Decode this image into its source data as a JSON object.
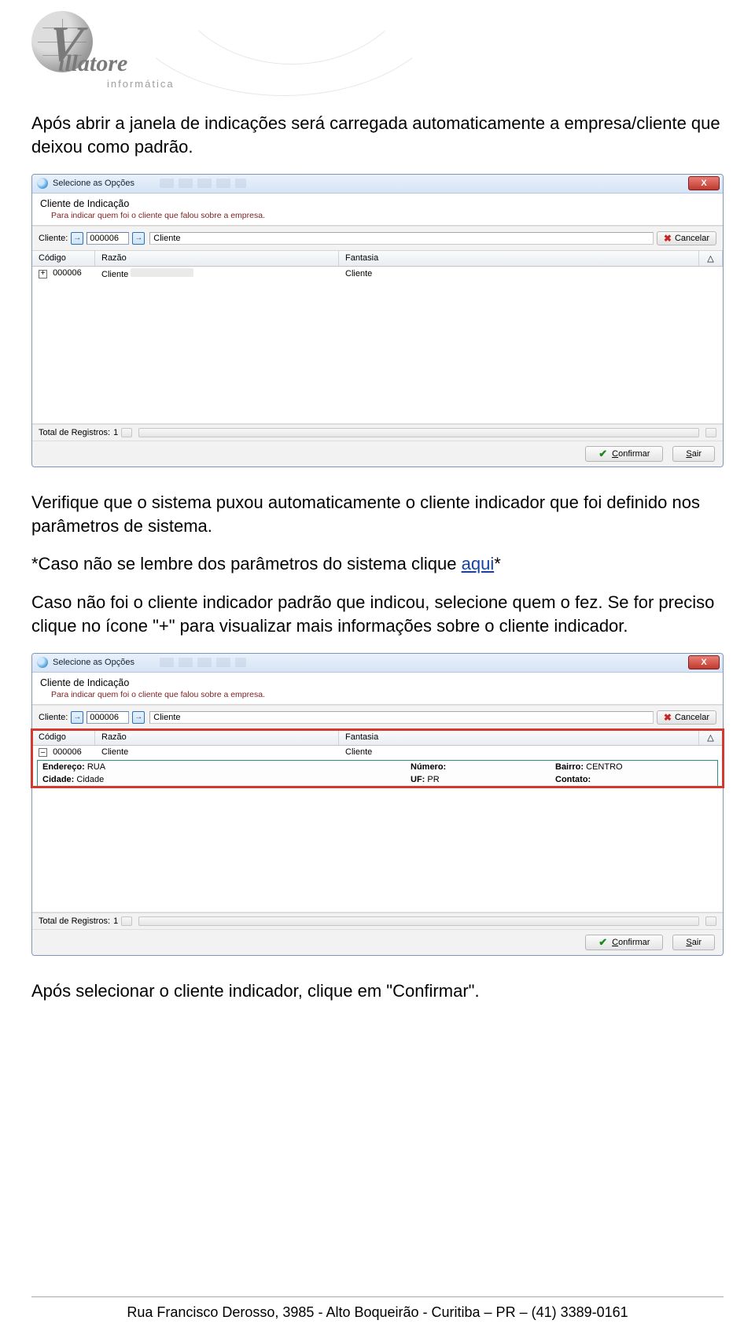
{
  "logo": {
    "wordmark": "illatore",
    "tag": "informática",
    "initial": "V"
  },
  "body": {
    "p1": "Após abrir a janela de indicações será carregada automaticamente a empresa/cliente que deixou como padrão.",
    "p2": "Verifique que o sistema puxou automaticamente o cliente indicador que foi definido nos parâmetros de sistema.",
    "p3_pre": "*Caso não se lembre dos parâmetros do sistema clique ",
    "p3_link": "aqui",
    "p3_post": "*",
    "p4": "Caso não foi o cliente indicador padrão que indicou, selecione quem o fez. Se for preciso clique no ícone \"+\" para visualizar mais informações sobre o cliente indicador.",
    "p5": "Após selecionar o cliente indicador, clique em \"Confirmar\"."
  },
  "window": {
    "title": "Selecione as Opções",
    "close_glyph": "X",
    "section_title": "Cliente de Indicação",
    "section_sub": "Para indicar quem foi o cliente que falou sobre a empresa.",
    "toolbar": {
      "cliente_label": "Cliente:",
      "code": "000006",
      "name": "Cliente",
      "cancel": "Cancelar"
    },
    "grid": {
      "col_codigo": "Código",
      "col_razao": "Razão",
      "col_fantasia": "Fantasia",
      "col_tri": "△",
      "row0": {
        "codigo": "000006",
        "razao": "Cliente",
        "fantasia": "Cliente"
      }
    },
    "details": {
      "endereco_l": "Endereço:",
      "endereco_v": "RUA",
      "numero_l": "Número:",
      "numero_v": "",
      "bairro_l": "Bairro:",
      "bairro_v": "CENTRO",
      "cidade_l": "Cidade:",
      "cidade_v": "Cidade",
      "uf_l": "UF:",
      "uf_v": "PR",
      "contato_l": "Contato:",
      "contato_v": ""
    },
    "footer": {
      "total_label": "Total de Registros:",
      "total": "1"
    },
    "buttons": {
      "confirm": "Confirmar",
      "confirm_ul": "C",
      "exit": "Sair",
      "exit_ul": "S"
    }
  },
  "page_footer": "Rua Francisco Derosso, 3985  - Alto Boqueirão - Curitiba – PR  – (41) 3389-0161"
}
